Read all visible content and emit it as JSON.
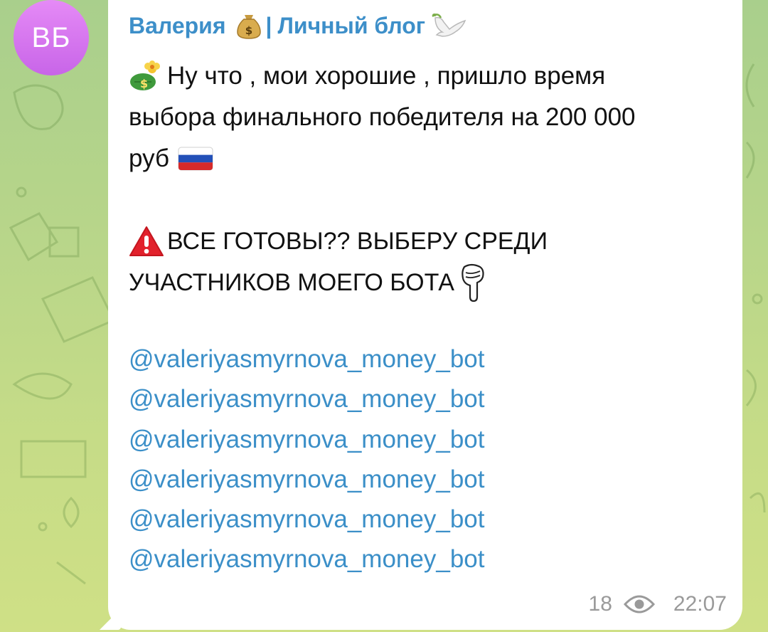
{
  "avatar": {
    "initials": "ВБ",
    "color": "#d277ef"
  },
  "channel": {
    "name": "Валерия",
    "separator": "|",
    "subtitle": "Личный блог",
    "name_icon": "money-bag-icon",
    "subtitle_icon": "dove-icon"
  },
  "message": {
    "intro_lines": [
      "Ну что , мои хорошие , пришло время",
      "выбора финального победителя на 200 000",
      "руб"
    ],
    "caps_lines": [
      "ВСЕ ГОТОВЫ?? ВЫБЕРУ СРЕДИ",
      "УЧАСТНИКОВ МОЕГО БОТА"
    ],
    "links": [
      "@valeriyasmyrnova_money_bot",
      "@valeriyasmyrnova_money_bot",
      "@valeriyasmyrnova_money_bot",
      "@valeriyasmyrnova_money_bot",
      "@valeriyasmyrnova_money_bot",
      "@valeriyasmyrnova_money_bot"
    ],
    "icons": [
      "money-bag-flower-icon",
      "russia-flag-icon",
      "warning-icon",
      "pointing-down-icon"
    ]
  },
  "meta": {
    "views": "18",
    "time": "22:07",
    "views_icon": "eye-icon"
  },
  "colors": {
    "link": "#3b8fc8",
    "sender": "#3d8fc9",
    "meta": "#9a9a9a"
  }
}
